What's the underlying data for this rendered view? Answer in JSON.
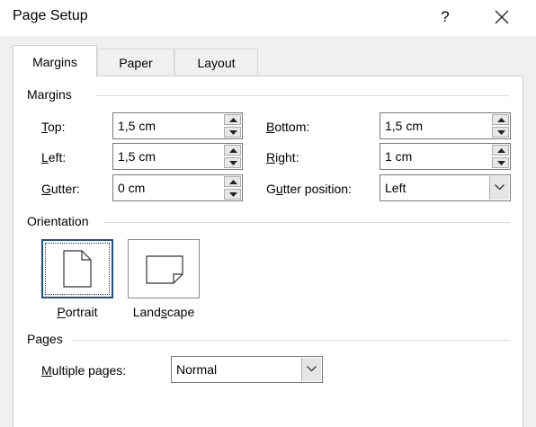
{
  "window": {
    "title": "Page Setup",
    "help_label": "?",
    "close_icon": "close-icon"
  },
  "tabs": [
    {
      "label": "Margins",
      "active": true
    },
    {
      "label": "Paper",
      "active": false
    },
    {
      "label": "Layout",
      "active": false
    }
  ],
  "margins": {
    "group_title": "Margins",
    "top": {
      "label_u": "T",
      "label_rest": "op:",
      "value": "1,5 cm"
    },
    "bottom": {
      "label_u": "B",
      "label_rest": "ottom:",
      "value": "1,5 cm"
    },
    "left": {
      "label_u": "L",
      "label_rest": "eft:",
      "value": "1,5 cm"
    },
    "right": {
      "label_u": "R",
      "label_rest": "ight:",
      "value": "1 cm"
    },
    "gutter": {
      "label_u": "G",
      "label_rest": "utter:",
      "value": "0 cm"
    },
    "gutter_position": {
      "label_pre": "G",
      "label_u": "u",
      "label_rest": "tter position:",
      "value": "Left"
    }
  },
  "orientation": {
    "group_title": "Orientation",
    "portrait": {
      "label_u": "P",
      "label_rest": "ortrait",
      "selected": true
    },
    "landscape": {
      "label_pre": "Land",
      "label_u": "s",
      "label_rest": "cape",
      "selected": false
    }
  },
  "pages": {
    "group_title": "Pages",
    "multiple_pages": {
      "label_u": "M",
      "label_rest": "ultiple pages:",
      "value": "Normal"
    }
  }
}
